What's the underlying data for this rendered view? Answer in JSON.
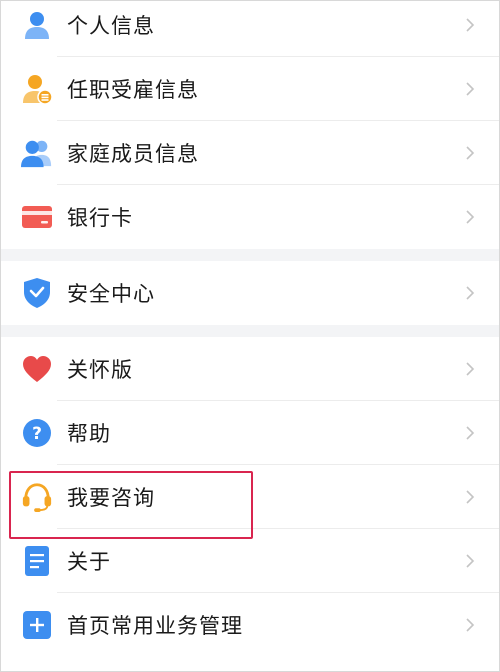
{
  "menu": {
    "groups": [
      {
        "items": [
          {
            "label": "个人信息",
            "icon": "person-icon",
            "color": "#3d8ef0"
          },
          {
            "label": "任职受雇信息",
            "icon": "employee-badge-icon",
            "color": "#f5a623"
          },
          {
            "label": "家庭成员信息",
            "icon": "family-icon",
            "color": "#3d8ef0"
          },
          {
            "label": "银行卡",
            "icon": "bank-card-icon",
            "color": "#f25c54"
          }
        ]
      },
      {
        "items": [
          {
            "label": "安全中心",
            "icon": "shield-icon",
            "color": "#3d8ef0"
          }
        ]
      },
      {
        "items": [
          {
            "label": "关怀版",
            "icon": "heart-icon",
            "color": "#e84a4a"
          },
          {
            "label": "帮助",
            "icon": "help-question-icon",
            "color": "#3d8ef0"
          },
          {
            "label": "我要咨询",
            "icon": "headset-icon",
            "color": "#f5a623",
            "highlighted": true
          },
          {
            "label": "关于",
            "icon": "document-icon",
            "color": "#3d8ef0"
          },
          {
            "label": "首页常用业务管理",
            "icon": "plus-box-icon",
            "color": "#3d8ef0"
          }
        ]
      }
    ]
  },
  "colors": {
    "highlight_border": "#d9254f",
    "chevron": "#c4c4c4",
    "section_gap": "#f3f4f6"
  }
}
